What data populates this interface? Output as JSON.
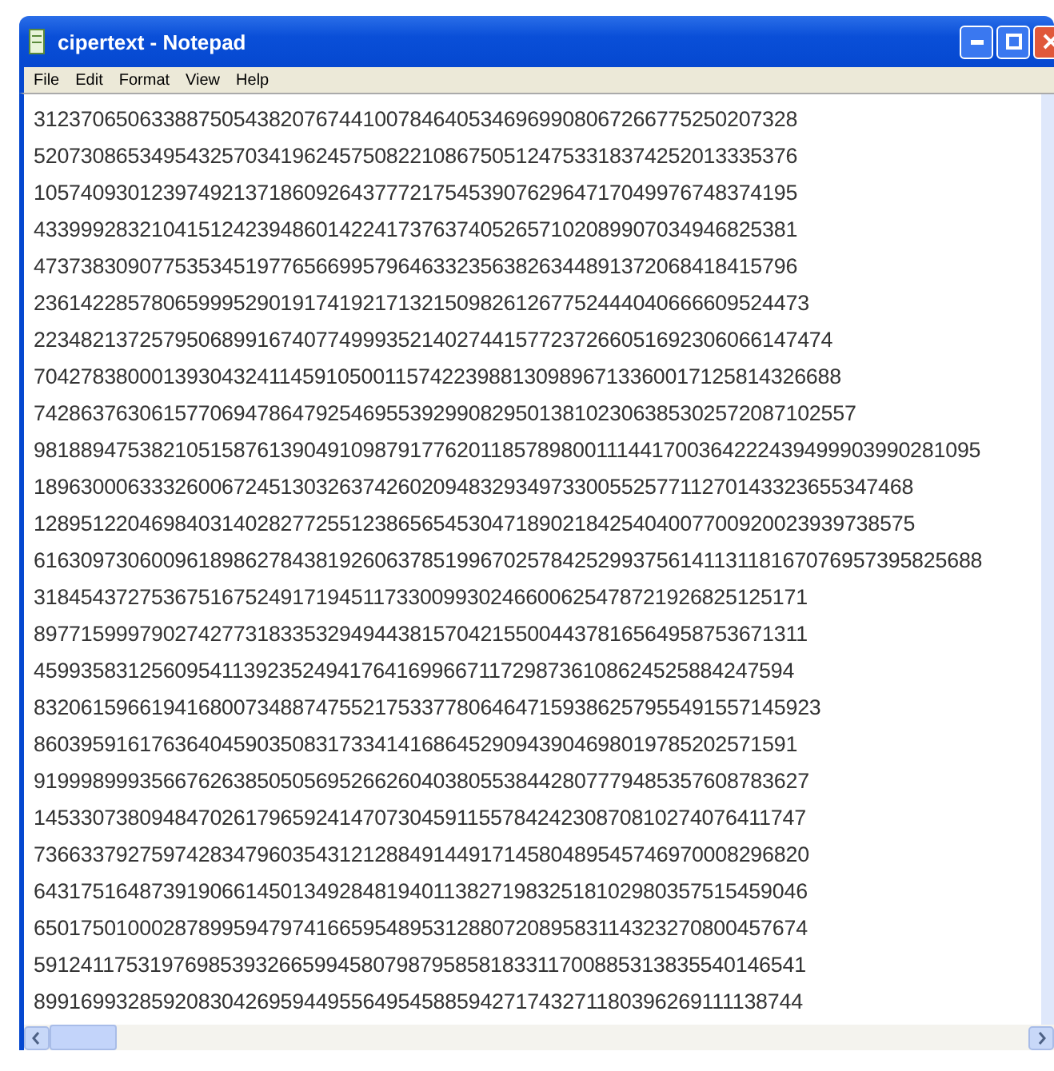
{
  "window": {
    "title": "cipertext - Notepad"
  },
  "menu": [
    {
      "label": "File"
    },
    {
      "label": "Edit"
    },
    {
      "label": "Format"
    },
    {
      "label": "View"
    },
    {
      "label": "Help"
    }
  ],
  "text_lines": [
    "31237065063388750543820767441007846405346969908067266775250207328",
    "52073086534954325703419624575082210867505124753318374252013335376",
    "10574093012397492137186092643777217545390762964717049976748374195",
    "43399928321041512423948601422417376374052657102089907034946825381",
    "47373830907753534519776566995796463323563826344891372068418415796",
    "236142285780659995290191741921713215098261267752444040666609524473",
    "22348213725795068991674077499935214027441577237266051692306066147474",
    "704278380001393043241145910500115742239881309896713360017125814326688",
    "7428637630615770694786479254695539299082950138102306385302572087102557",
    "981889475382105158761390491098791776201185789800111441700364222439499903990281095",
    "189630006333260067245130326374260209483293497330055257711270143323655347468",
    "128951220469840314028277255123865654530471890218425404007700920023939738575",
    "616309730600961898627843819260637851996702578425299375614113118167076957395825688",
    "318454372753675167524917194511733009930246600625478721926825125171",
    "897715999790274277318335329494438157042155004437816564958753671311",
    "45993583125609541139235249417641699667117298736108624525884247594",
    "8320615966194168007348874755217533778064647159386257955491557145923",
    "86039591617636404590350831733414168645290943904698019785202571591",
    "919998999356676263850505695266260403805538442807779485357608783627",
    "145330738094847026179659241470730459115578424230870810274076411747",
    "736633792759742834796035431212884914491714580489545746970008296820",
    "643175164873919066145013492848194011382719832518102980357515459046",
    "650175010002878995947974166595489531288072089583114323270800457674",
    "591241175319769853932665994580798795858183311700885313835540146541",
    "899169932859208304269594495564954588594271743271180396269111138744"
  ]
}
